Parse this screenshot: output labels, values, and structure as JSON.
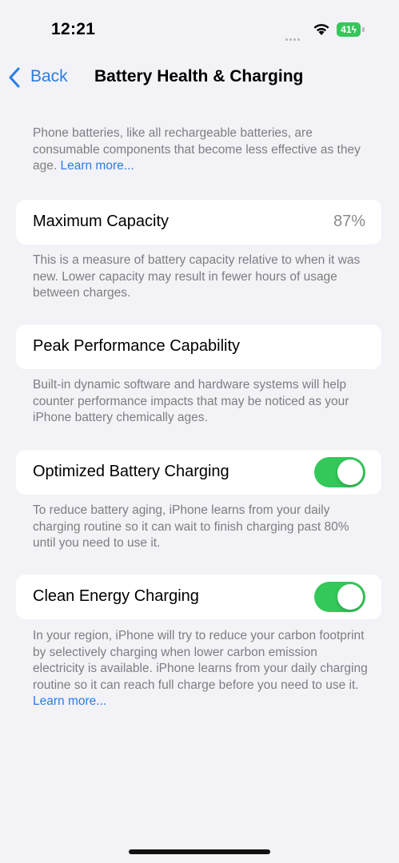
{
  "status_bar": {
    "time": "12:21",
    "battery_level": "41",
    "icons": [
      "signal-icon",
      "wifi-icon",
      "battery-icon"
    ]
  },
  "nav": {
    "back_label": "Back",
    "title": "Battery Health & Charging"
  },
  "intro": {
    "text": "Phone batteries, like all rechargeable batteries, are consumable components that become less effective as they age.",
    "link": "Learn more..."
  },
  "max_capacity": {
    "label": "Maximum Capacity",
    "value": "87%",
    "footer": "This is a measure of battery capacity relative to when it was new. Lower capacity may result in fewer hours of usage between charges."
  },
  "peak_performance": {
    "label": "Peak Performance Capability",
    "footer": "Built-in dynamic software and hardware systems will help counter performance impacts that may be noticed as your iPhone battery chemically ages."
  },
  "optimized_charging": {
    "label": "Optimized Battery Charging",
    "enabled": true,
    "footer": "To reduce battery aging, iPhone learns from your daily charging routine so it can wait to finish charging past 80% until you need to use it."
  },
  "clean_energy": {
    "label": "Clean Energy Charging",
    "enabled": true,
    "footer": "In your region, iPhone will try to reduce your carbon footprint by selectively charging when lower carbon emission electricity is available. iPhone learns from your daily charging routine so it can reach full charge before you need to use it.",
    "link": "Learn more..."
  },
  "colors": {
    "accent": "#2a7de1",
    "toggle_on": "#34c759",
    "background": "#f2f2f7",
    "secondary_text": "#7d7d82"
  }
}
